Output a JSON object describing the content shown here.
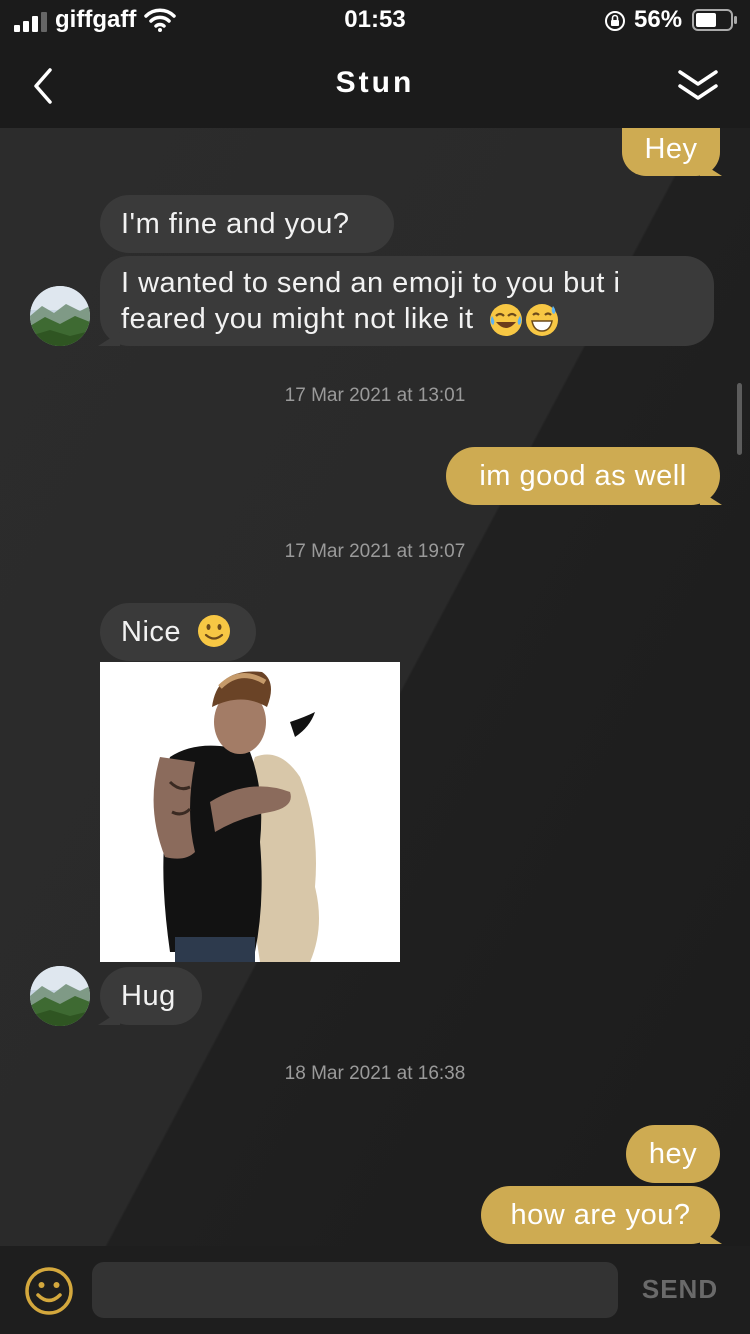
{
  "status_bar": {
    "carrier": "giffgaff",
    "time": "01:53",
    "battery_percent": "56%",
    "icons": [
      "signal-icon",
      "wifi-icon",
      "orientation-lock-icon",
      "battery-icon"
    ]
  },
  "header": {
    "title": "Stun",
    "back_icon": "chevron-left-icon",
    "collapse_icon": "double-chevron-down-icon"
  },
  "messages": [
    {
      "dir": "out",
      "text": "Hey"
    },
    {
      "dir": "in",
      "text": "I'm fine and you?"
    },
    {
      "dir": "in",
      "line1": "I wanted to send an emoji to you but i",
      "line2": "feared you might not like it",
      "emojis": [
        "tears-of-joy-emoji",
        "grinning-sweat-emoji"
      ]
    },
    {
      "dir": "stamp",
      "text": "17 Mar 2021 at 13:01"
    },
    {
      "dir": "out",
      "text": "im good as well"
    },
    {
      "dir": "stamp",
      "text": "17 Mar 2021 at 19:07"
    },
    {
      "dir": "in",
      "text": "Nice",
      "emojis": [
        "slightly-smiling-emoji"
      ]
    },
    {
      "dir": "in",
      "type": "image",
      "alt": "hug-photo"
    },
    {
      "dir": "in",
      "text": "Hug"
    },
    {
      "dir": "stamp",
      "text": "18 Mar 2021 at 16:38"
    },
    {
      "dir": "out",
      "text": "hey"
    },
    {
      "dir": "out",
      "text": "how are you?"
    }
  ],
  "composer": {
    "placeholder": "",
    "send_label": "SEND",
    "emoji_icon": "smiley-icon"
  },
  "colors": {
    "outgoing_bubble": "#ceab52",
    "incoming_bubble": "#3a3a3a",
    "background": "#262626"
  }
}
